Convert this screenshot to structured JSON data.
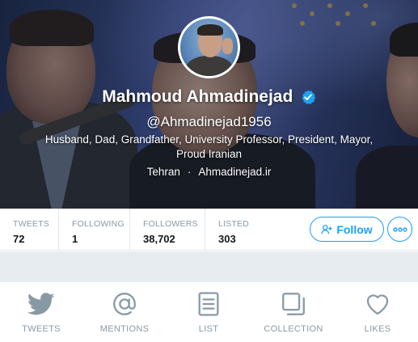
{
  "profile": {
    "name": "Mahmoud Ahmadinejad",
    "verified": true,
    "handle": "@Ahmadinejad1956",
    "bio_line1": "Husband, Dad, Grandfather, University Professor, President, Mayor,",
    "bio_line2": "Proud Iranian",
    "location": "Tehran",
    "separator": "·",
    "website": "Ahmadinejad.ir"
  },
  "stats": [
    {
      "label": "TWEETS",
      "value": "72"
    },
    {
      "label": "FOLLOWING",
      "value": "1"
    },
    {
      "label": "FOLLOWERS",
      "value": "38,702"
    },
    {
      "label": "LISTED",
      "value": "303"
    }
  ],
  "actions": {
    "follow_label": "Follow",
    "more_icon": "more-icon"
  },
  "tabs": [
    {
      "label": "TWEETS",
      "icon": "bird-icon"
    },
    {
      "label": "MENTIONS",
      "icon": "at-icon"
    },
    {
      "label": "LIST",
      "icon": "list-icon"
    },
    {
      "label": "COLLECTION",
      "icon": "collection-icon"
    },
    {
      "label": "LIKES",
      "icon": "heart-icon"
    }
  ],
  "colors": {
    "accent": "#1da1f2",
    "muted_text": "#8899a6",
    "divider": "#e1e8ed",
    "gap_background": "#e6ecf0"
  }
}
